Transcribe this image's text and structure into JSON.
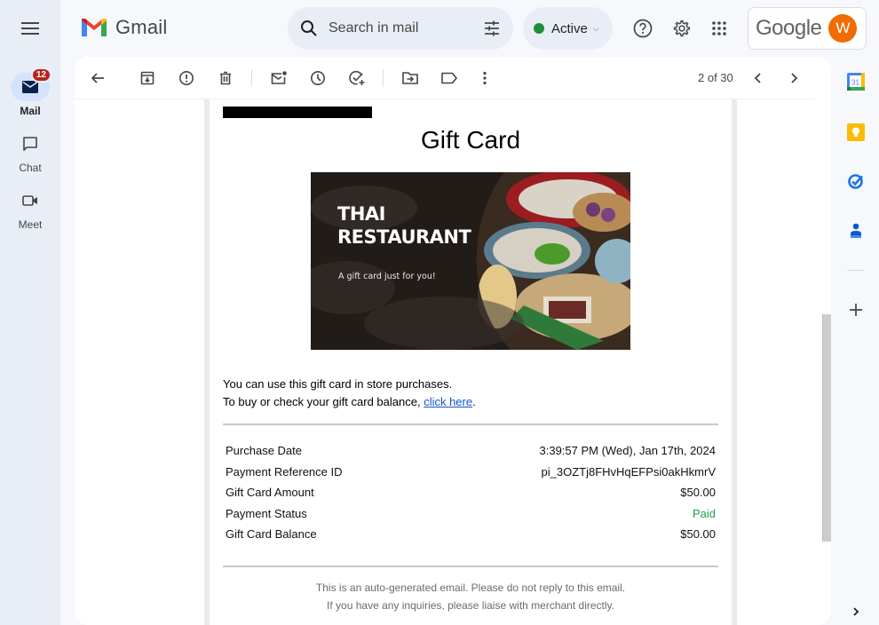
{
  "app": {
    "name": "Gmail",
    "brand_colors": {
      "red": "#ea4335",
      "blue": "#4285f4",
      "green": "#34a853",
      "yellow": "#fbbc04"
    }
  },
  "rail": {
    "menu_icon": "hamburger-menu-icon",
    "items": [
      {
        "label": "Mail",
        "icon": "mail-icon",
        "badge": "12",
        "active": true
      },
      {
        "label": "Chat",
        "icon": "chat-bubble-icon"
      },
      {
        "label": "Meet",
        "icon": "video-camera-icon"
      }
    ]
  },
  "header": {
    "search_placeholder": "Search in mail",
    "status": {
      "label": "Active",
      "color": "#1e8e3e"
    },
    "account": {
      "brand": "Google",
      "avatar_letter": "W",
      "avatar_color": "#ef6c00"
    }
  },
  "toolbar": {
    "actions": [
      "back",
      "archive",
      "report-spam",
      "delete",
      "mark-unread",
      "snooze",
      "add-to-tasks",
      "move-to",
      "labels",
      "more"
    ],
    "pager": "2 of 30"
  },
  "email": {
    "title": "Gift Card",
    "image": {
      "heading_line1": "THAI",
      "heading_line2": "RESTAURANT",
      "tagline": "A gift card just for you!"
    },
    "line1": "You can use this gift card in store purchases.",
    "line2_prefix": "To buy or check your gift card balance, ",
    "line2_link": "click here",
    "line2_suffix": ".",
    "details": [
      {
        "label": "Purchase Date",
        "value": "3:39:57 PM (Wed), Jan 17th, 2024"
      },
      {
        "label": "Payment Reference ID",
        "value": "pi_3OZTj8FHvHqEFPsi0akHkmrV"
      },
      {
        "label": "Gift Card Amount",
        "value": "$50.00"
      },
      {
        "label": "Payment Status",
        "value": "Paid",
        "status_color": "#1e9e4a"
      },
      {
        "label": "Gift Card Balance",
        "value": "$50.00"
      }
    ],
    "footer_line1": "This is an auto-generated email. Please do not reply to this email.",
    "footer_line2": "If you have any inquiries, please liaise with merchant directly."
  },
  "right_rail": {
    "apps": [
      "Calendar",
      "Keep",
      "Tasks",
      "Contacts"
    ],
    "calendar_day": "31"
  }
}
